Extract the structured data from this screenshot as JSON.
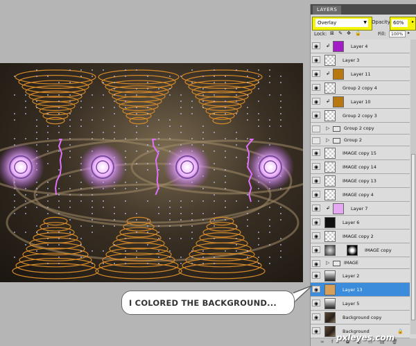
{
  "panel": {
    "tab": "LAYERS",
    "blend_mode": "Overlay",
    "opacity_label": "Opacity:",
    "opacity_value": "60%",
    "lock_label": "Lock:",
    "lock_icons": "⊠ ✎ ✥ 🔒",
    "fill_label": "Fill:",
    "fill_value": "100%",
    "bottom_icons": "∞ fx ◘ ◐ ▭ ▤ 🗑"
  },
  "layers": [
    {
      "name": "Layer 4",
      "thumb": "#a31bc6",
      "clip": true
    },
    {
      "name": "Layer 3",
      "thumb": "checker"
    },
    {
      "name": "Layer 11",
      "thumb": "#b8770f",
      "clip": true
    },
    {
      "name": "Group 2 copy 4",
      "thumb": "checker"
    },
    {
      "name": "Layer 10",
      "thumb": "#b8770f",
      "clip": true
    },
    {
      "name": "Group 2 copy 3",
      "thumb": "checker"
    },
    {
      "name": "Group 2 copy",
      "group": true
    },
    {
      "name": "Group 2",
      "group": true
    },
    {
      "name": "IMAGE copy 15",
      "thumb": "checker"
    },
    {
      "name": "IMAGE copy 14",
      "thumb": "checker"
    },
    {
      "name": "IMAGE copy 13",
      "thumb": "checker"
    },
    {
      "name": "IMAGE copy 4",
      "thumb": "checker"
    },
    {
      "name": "Layer 7",
      "thumb": "#e6a8f2",
      "clip": true
    },
    {
      "name": "Layer 6",
      "thumb": "#111111"
    },
    {
      "name": "IMAGE copy 2",
      "thumb": "checker"
    },
    {
      "name": "IMAGE copy",
      "thumb": "mask"
    },
    {
      "name": "IMAGE",
      "group": true
    },
    {
      "name": "Layer 2",
      "thumb": "gradient"
    },
    {
      "name": "Layer 13",
      "thumb": "#d6a05a",
      "selected": true
    },
    {
      "name": "Layer 5",
      "thumb": "gradient"
    },
    {
      "name": "Background copy",
      "thumb": "photo"
    },
    {
      "name": "Background",
      "thumb": "photo",
      "locked": true
    }
  ],
  "callout": {
    "text": "I COLORED THE BACKGROUND..."
  },
  "watermark": "pxleyes.com"
}
